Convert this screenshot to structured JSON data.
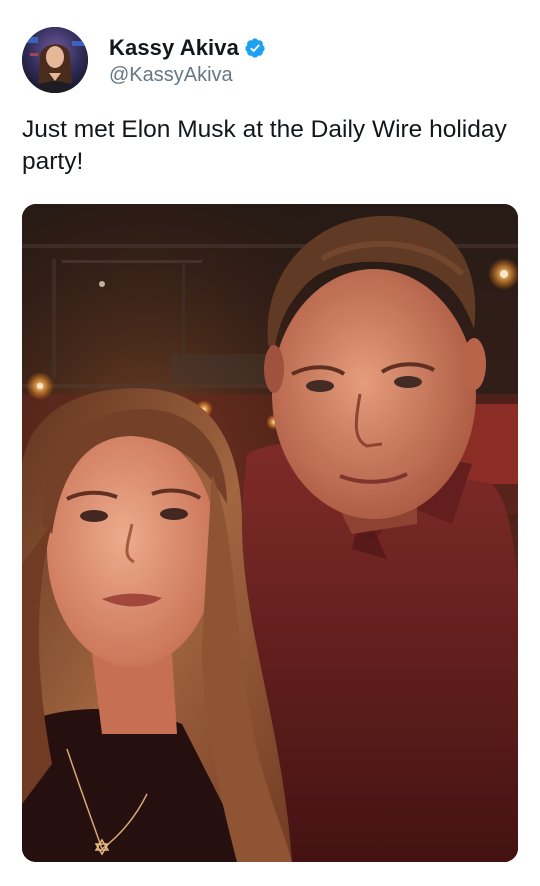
{
  "tweet": {
    "author": {
      "display_name": "Kassy Akiva",
      "handle": "@KassyAkiva",
      "verified": true,
      "avatar": "profile-photo"
    },
    "text": "Just met Elon Musk at the Daily Wire holiday party!",
    "media": {
      "type": "photo",
      "description_icon": "selfie-photo"
    }
  },
  "colors": {
    "verified_blue": "#1da1f2",
    "text_primary": "#14171a",
    "text_secondary": "#657786"
  }
}
